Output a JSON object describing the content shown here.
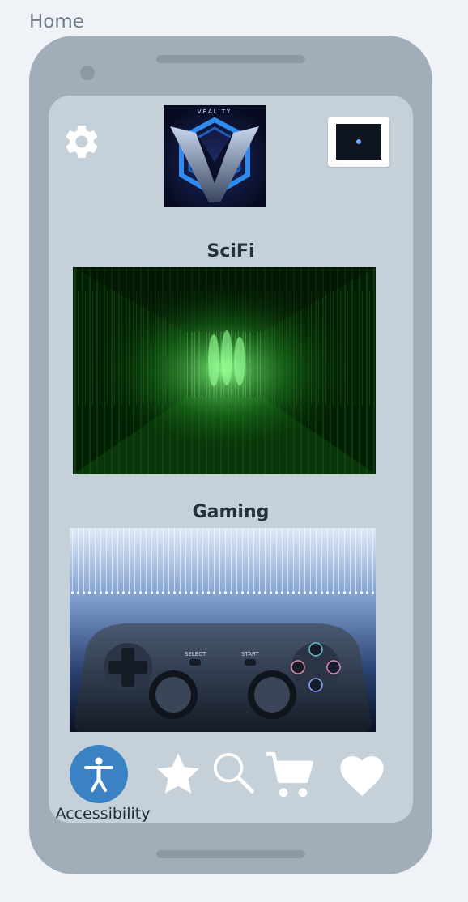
{
  "frame_label": "Home",
  "logo_text": "VEALITY",
  "categories": [
    {
      "title": "SciFi"
    },
    {
      "title": "Gaming"
    }
  ],
  "gamepad": {
    "select_label": "SELECT",
    "start_label": "START"
  },
  "nav": {
    "accessibility_label": "Accessibility",
    "items": [
      "accessibility-icon",
      "star-icon",
      "search-icon",
      "cart-icon",
      "heart-icon"
    ]
  },
  "colors": {
    "background": "#eff3f7",
    "phone_body": "#a1adb9",
    "screen": "#c5d0d9",
    "accent": "#3b82c4"
  }
}
